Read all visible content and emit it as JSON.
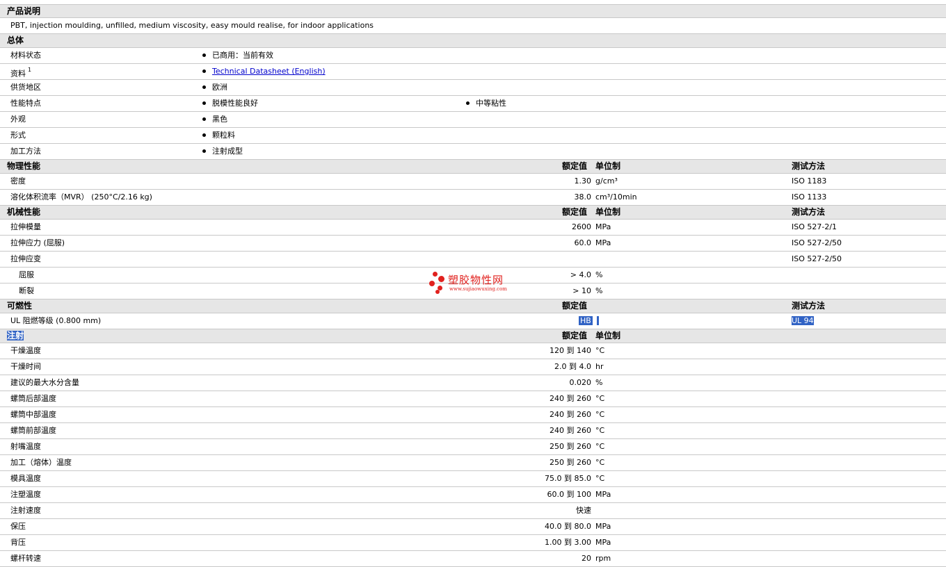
{
  "desc": {
    "title": "产品说明",
    "text": "PBT, injection moulding, unfilled, medium viscosity, easy mould realise, for indoor applications"
  },
  "general": {
    "title": "总体",
    "rows": [
      {
        "label": "材料状态",
        "value": "已商用：当前有效"
      },
      {
        "label": "资料",
        "sup": "1",
        "value": "Technical Datasheet (English)"
      },
      {
        "label": "供货地区",
        "value": "欧洲"
      },
      {
        "label": "性能特点",
        "value": "脱模性能良好",
        "value2": "中等粘性"
      },
      {
        "label": "外观",
        "value": "黑色"
      },
      {
        "label": "形式",
        "value": "颗粒料"
      },
      {
        "label": "加工方法",
        "value": "注射成型"
      }
    ]
  },
  "physical": {
    "title": "物理性能",
    "h_value": "额定值",
    "h_unit": "单位制",
    "h_test": "测试方法",
    "rows": [
      {
        "label": "密度",
        "value": "1.30",
        "unit": "g/cm³",
        "test": "ISO 1183"
      },
      {
        "label": "溶化体积流率（MVR） (250°C/2.16 kg)",
        "value": "38.0",
        "unit": "cm³/10min",
        "test": "ISO 1133"
      }
    ]
  },
  "mechanical": {
    "title": "机械性能",
    "h_value": "额定值",
    "h_unit": "单位制",
    "h_test": "测试方法",
    "rows": [
      {
        "label": "拉伸模量",
        "value": "2600",
        "unit": "MPa",
        "test": "ISO 527-2/1"
      },
      {
        "label": "拉伸应力 (屈服)",
        "value": "60.0",
        "unit": "MPa",
        "test": "ISO 527-2/50"
      },
      {
        "label": "拉伸应变",
        "value": "",
        "unit": "",
        "test": "ISO 527-2/50"
      },
      {
        "label": "屈服",
        "value": "> 4.0",
        "unit": "%",
        "test": ""
      },
      {
        "label": "断裂",
        "value": "> 10",
        "unit": "%",
        "test": ""
      }
    ]
  },
  "flammability": {
    "title": "可燃性",
    "h_value": "额定值",
    "h_test": "测试方法",
    "rows": [
      {
        "label": "UL 阻燃等级 (0.800 mm)",
        "value": "HB",
        "test": "UL 94"
      }
    ]
  },
  "injection": {
    "title": "注射",
    "h_value": "额定值",
    "h_unit": "单位制",
    "rows": [
      {
        "label": "干燥温度",
        "value": "120 到  140",
        "unit": "°C"
      },
      {
        "label": "干燥时间",
        "value": "2.0 到  4.0",
        "unit": "hr"
      },
      {
        "label": "建议的最大水分含量",
        "value": "0.020",
        "unit": "%"
      },
      {
        "label": "螺筒后部温度",
        "value": "240 到  260",
        "unit": "°C"
      },
      {
        "label": "螺筒中部温度",
        "value": "240 到  260",
        "unit": "°C"
      },
      {
        "label": "螺筒前部温度",
        "value": "240 到  260",
        "unit": "°C"
      },
      {
        "label": "射嘴温度",
        "value": "250 到  260",
        "unit": "°C"
      },
      {
        "label": "加工（熔体）温度",
        "value": "250 到  260",
        "unit": "°C"
      },
      {
        "label": "模具温度",
        "value": "75.0 到  85.0",
        "unit": "°C"
      },
      {
        "label": "注塑温度",
        "value": "60.0 到  100",
        "unit": "MPa"
      },
      {
        "label": "注射速度",
        "value": "快速",
        "unit": ""
      },
      {
        "label": "保压",
        "value": "40.0 到  80.0",
        "unit": "MPa"
      },
      {
        "label": "背压",
        "value": "1.00 到  3.00",
        "unit": "MPa"
      },
      {
        "label": "螺杆转速",
        "value": "20",
        "unit": "rpm"
      }
    ]
  },
  "watermark": {
    "name": "塑胶物性网",
    "url": "www.sujiaowuxing.com",
    "color": "#e1211e"
  }
}
